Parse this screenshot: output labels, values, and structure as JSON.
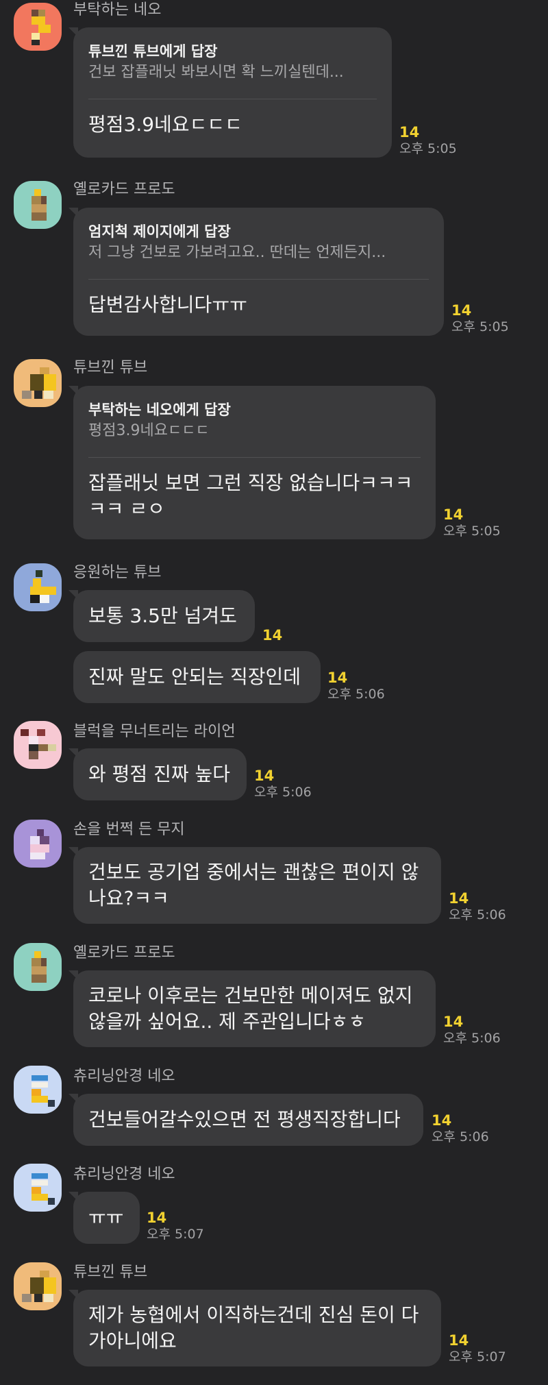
{
  "messages": [
    {
      "sender": "부탁하는 네오",
      "reply": {
        "to": "튜브낀 튜브에게 답장",
        "quote": "건보 잡플래닛 봐보시면 확 느끼실텐데..."
      },
      "text": "평점3.9네요ㄷㄷㄷ",
      "count": "14",
      "time": "오후 5:05"
    },
    {
      "sender": "옐로카드 프로도",
      "reply": {
        "to": "엄지척 제이지에게 답장",
        "quote": "저 그냥 건보로 가보려고요.. 딴데는 언제든지..."
      },
      "text": "답변감사합니다ㅠㅠ",
      "count": "14",
      "time": "오후 5:05"
    },
    {
      "sender": "튜브낀 튜브",
      "reply": {
        "to": "부탁하는 네오에게 답장",
        "quote": "평점3.9네요ㄷㄷㄷ"
      },
      "text": "잡플래닛 보면 그런 직장 없습니다ㅋㅋㅋㅋㅋ ㄹㅇ",
      "count": "14",
      "time": "오후 5:05"
    },
    {
      "sender": "응원하는 튜브",
      "text": "보통 3.5만 넘겨도",
      "count": "14",
      "time": ""
    },
    {
      "text": "진짜 말도 안되는 직장인데",
      "count": "14",
      "time": "오후 5:06"
    },
    {
      "sender": "블럭을 무너트리는 라이언",
      "text": "와 평점 진짜 높다",
      "count": "14",
      "time": "오후 5:06"
    },
    {
      "sender": "손을 번쩍 든 무지",
      "text": "건보도 공기업 중에서는 괜찮은 편이지 않나요?ㅋㅋ",
      "count": "14",
      "time": "오후 5:06"
    },
    {
      "sender": "옐로카드 프로도",
      "text": "코로나 이후로는 건보만한 메이져도 없지 않을까 싶어요.. 제 주관입니다ㅎㅎ",
      "count": "14",
      "time": "오후 5:06"
    },
    {
      "sender": "츄리닝안경 네오",
      "text": "건보들어갈수있으면 전 평생직장합니다",
      "count": "14",
      "time": "오후 5:06"
    },
    {
      "sender": "츄리닝안경 네오",
      "text": "ㅠㅠ",
      "count": "14",
      "time": "오후 5:07"
    },
    {
      "sender": "튜브낀 튜브",
      "text": "제가 농협에서 이직하는건데 진심 돈이 다 가아니에요",
      "count": "14",
      "time": "오후 5:07"
    }
  ],
  "avatar_colors": {
    "neo": "#f2775e",
    "frodo": "#8ed1c1",
    "tube": "#f0bb7a",
    "tube_cheer": "#8fa8da",
    "ryan": "#f7c9d3",
    "muzi": "#a893d8",
    "neo_glasses": "#c9d9f4"
  }
}
